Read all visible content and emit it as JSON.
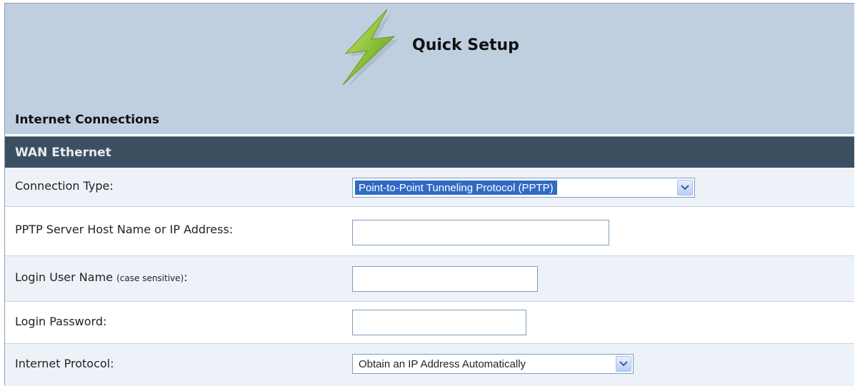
{
  "header": {
    "title": "Quick Setup",
    "icon": "lightning-bolt-icon"
  },
  "section": {
    "title": "Internet Connections"
  },
  "wan": {
    "title": "WAN Ethernet"
  },
  "form": {
    "connection_type": {
      "label": "Connection Type:",
      "value": "Point-to-Point Tunneling Protocol (PPTP)"
    },
    "pptp_server": {
      "label": "PPTP Server Host Name or IP Address:",
      "value": "",
      "placeholder": ""
    },
    "login_user": {
      "label": "Login User Name",
      "note": "(case sensitive)",
      "suffix": ":",
      "value": "",
      "placeholder": ""
    },
    "login_password": {
      "label": "Login Password:",
      "value": "",
      "placeholder": ""
    },
    "internet_protocol": {
      "label": "Internet Protocol:",
      "value": "Obtain an IP Address Automatically"
    }
  },
  "colors": {
    "header_bg": "#c0cfe0",
    "wan_bar_bg": "#3c4f61",
    "row_alt_bg": "#edf2f8",
    "selected_bg": "#316ac5"
  }
}
